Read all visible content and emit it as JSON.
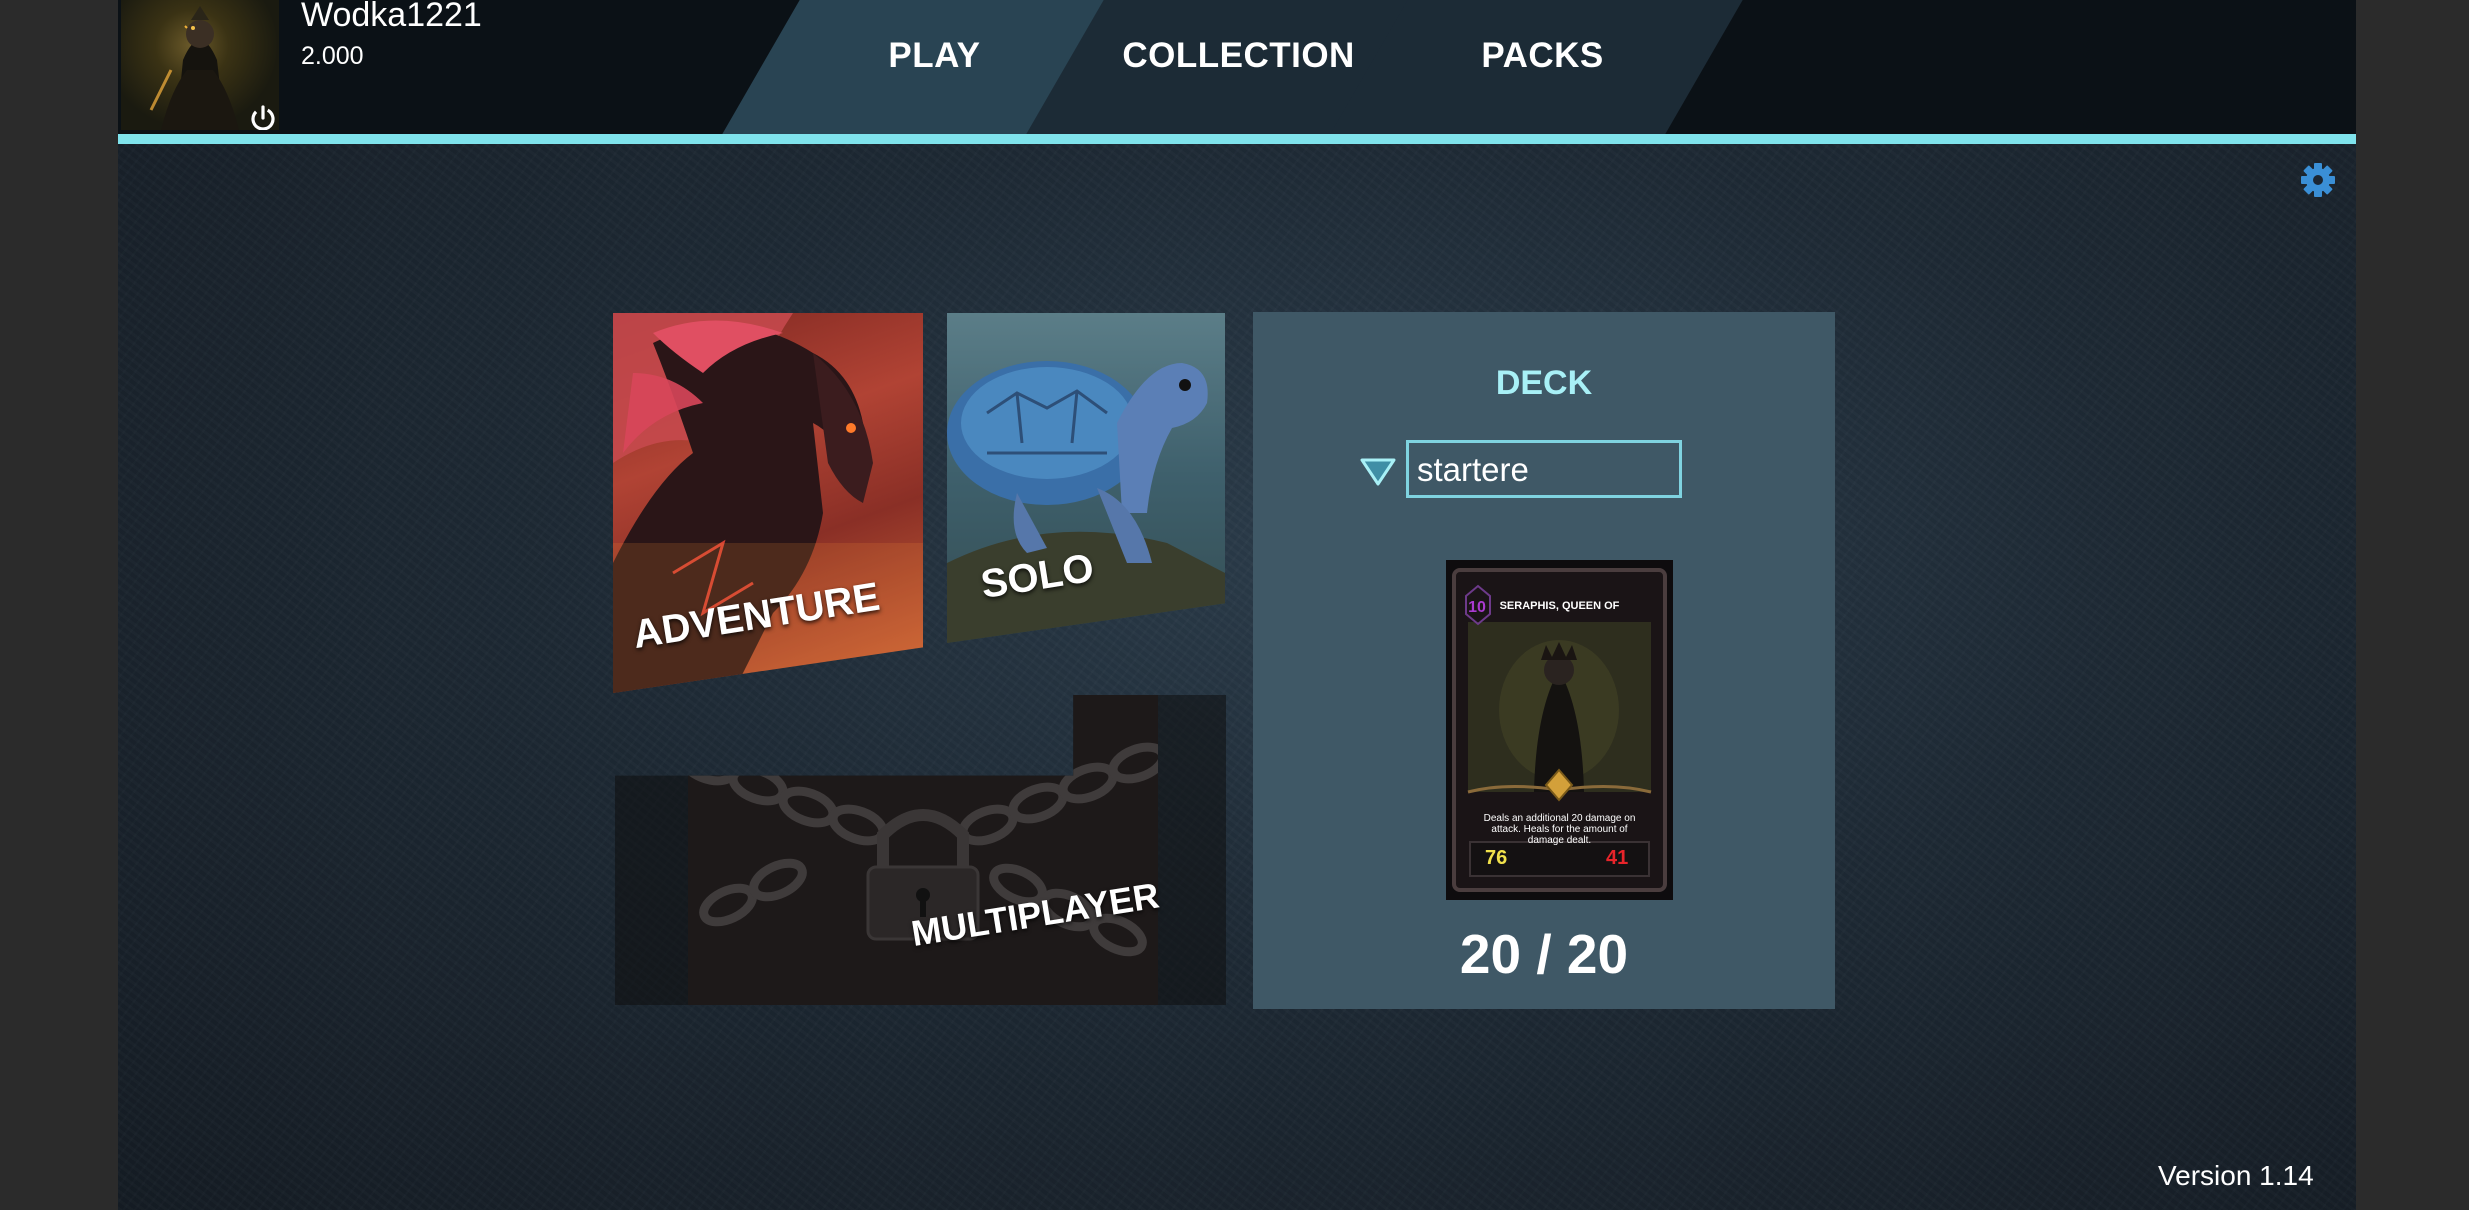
{
  "profile": {
    "username": "Wodka1221",
    "credits": "2.000"
  },
  "nav": {
    "tabs": [
      {
        "label": "PLAY"
      },
      {
        "label": "COLLECTION"
      },
      {
        "label": "PACKS"
      }
    ],
    "active": "PLAY"
  },
  "modes": {
    "adventure": "ADVENTURE",
    "solo": "SOLO",
    "multiplayer": "MULTIPLAYER",
    "multiplayer_locked": true
  },
  "deck": {
    "title": "DECK",
    "selected": "startere",
    "count": "20 / 20",
    "card": {
      "name": "SERAPHIS, QUEEN OF",
      "cost": "10",
      "text": "Deals an additional 20 damage on attack. Heals for the amount of damage dealt.",
      "attack": "76",
      "health": "41"
    }
  },
  "version": "Version 1.14",
  "colors": {
    "accent": "#7fe3ec",
    "deck_title": "#a8f0f6",
    "panel": "#3f5866"
  },
  "icons": {
    "power": "power-icon",
    "settings": "gear-icon",
    "dropdown": "triangle-down-icon",
    "lock": "padlock-icon"
  }
}
